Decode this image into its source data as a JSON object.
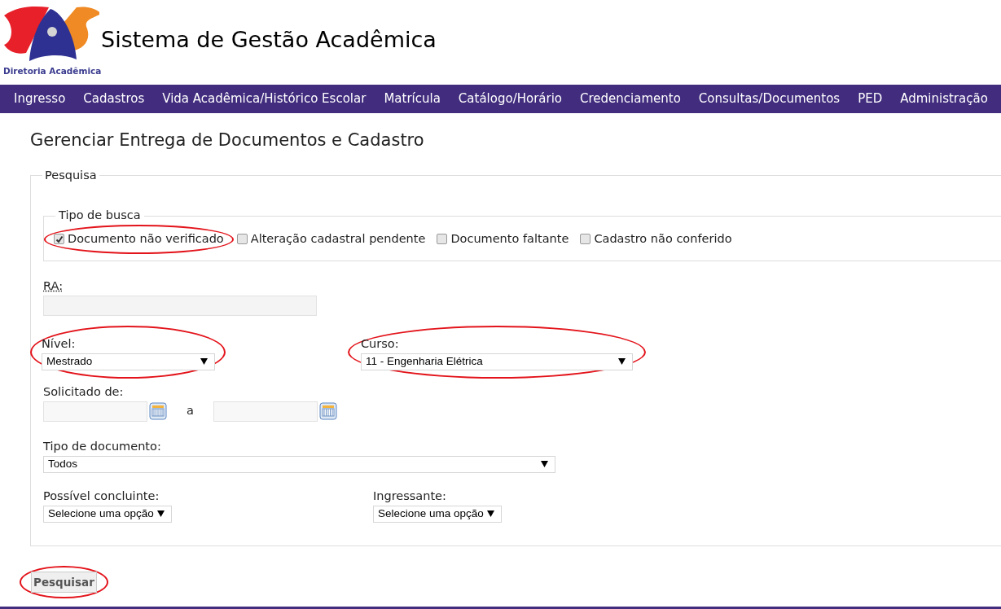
{
  "header": {
    "logo_caption": "Diretoria Acadêmica",
    "title": "Sistema de Gestão Acadêmica"
  },
  "nav": [
    "Ingresso",
    "Cadastros",
    "Vida Acadêmica/Histórico Escolar",
    "Matrícula",
    "Catálogo/Horário",
    "Credenciamento",
    "Consultas/Documentos",
    "PED",
    "Administração"
  ],
  "page_title": "Gerenciar Entrega de Documentos e Cadastro",
  "search": {
    "legend": "Pesquisa",
    "search_type": {
      "legend": "Tipo de busca",
      "options": [
        {
          "label": "Documento não verificado",
          "checked": true,
          "highlighted": true
        },
        {
          "label": "Alteração cadastral pendente",
          "checked": false,
          "highlighted": false
        },
        {
          "label": "Documento faltante",
          "checked": false,
          "highlighted": false
        },
        {
          "label": "Cadastro não conferido",
          "checked": false,
          "highlighted": false
        }
      ]
    },
    "ra": {
      "label": "RA:"
    },
    "nivel": {
      "label": "Nível:",
      "value": "Mestrado",
      "highlighted": true
    },
    "curso": {
      "label": "Curso:",
      "value": "11 - Engenharia Elétrica",
      "highlighted": true
    },
    "solicitado": {
      "label": "Solicitado de:",
      "separator": "a"
    },
    "tipo_documento": {
      "label": "Tipo de documento:",
      "value": "Todos"
    },
    "possivel_concluinte": {
      "label": "Possível concluinte:",
      "value": "Selecione uma opção"
    },
    "ingressante": {
      "label": "Ingressante:",
      "value": "Selecione uma opção"
    }
  },
  "submit": {
    "label": "Pesquisar",
    "highlighted": true
  }
}
